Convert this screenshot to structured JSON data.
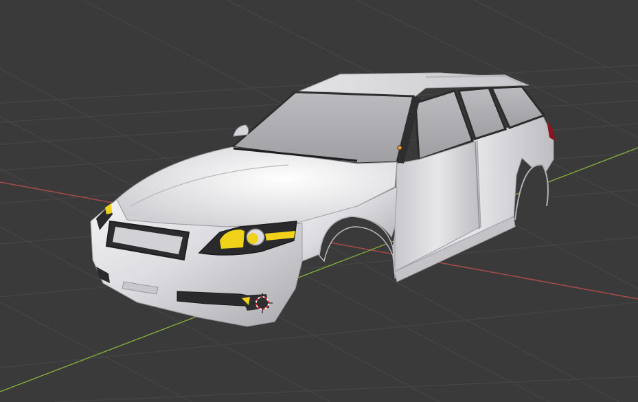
{
  "viewport": {
    "background_color": "#3a3a3a",
    "grid_color": "#4a4a4a",
    "x_axis_color": "#a94a4a",
    "y_axis_color": "#7fa43a",
    "origin_marker": "origin-icon",
    "object_origin_marker": "object-origin-dot"
  },
  "scene": {
    "object": "car-body-mesh",
    "body_color": "#d8d8dc",
    "headlight_color": "#f0d21a",
    "taillight_color": "#8a1420",
    "selection_origin_color": "#f29a2e"
  }
}
